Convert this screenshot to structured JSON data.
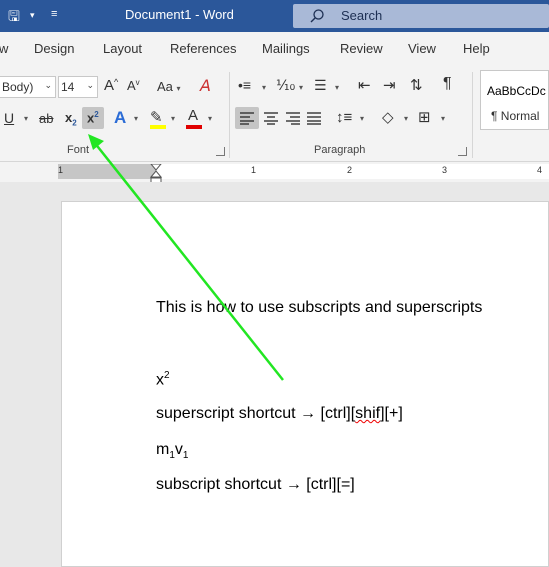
{
  "titlebar": {
    "autosave_icon": "autosave-icon",
    "doc_title": "Document1  -  Word",
    "search_placeholder": "Search",
    "bg_color": "#2b579a"
  },
  "tabs": [
    "w",
    "Design",
    "Layout",
    "References",
    "Mailings",
    "Review",
    "View",
    "Help"
  ],
  "ribbon": {
    "font_name": "Body)",
    "font_size": "14",
    "grow_font": "A",
    "shrink_font": "A",
    "change_case": "Aa",
    "underline": "U",
    "strike": "ab",
    "subscript_main": "x",
    "subscript_sub": "2",
    "superscript_main": "x",
    "superscript_sup": "2",
    "font_group_label": "Font",
    "paragraph_group_label": "Paragraph",
    "pilcrow": "¶",
    "styles": {
      "sample": "AaBbCcDc",
      "name": "¶ Normal"
    },
    "highlight_color": "#ffff00",
    "font_color": "#e00000"
  },
  "ruler": {
    "numbers": [
      "1",
      "1",
      "2",
      "3",
      "4"
    ]
  },
  "document": {
    "line1": "This is how to use subscripts and superscripts",
    "line2_base": "x",
    "line2_sup": "2",
    "line3_prefix": "superscript shortcut → [ctrl][",
    "line3_misspelled": "shif",
    "line3_suffix": "][+]",
    "line4_m": "m",
    "line4_m_sub": "1",
    "line4_v": "v",
    "line4_v_sub": "1",
    "line5": "subscript shortcut → [ctrl][=]"
  },
  "annotation": {
    "arrow_color": "#22e622"
  }
}
